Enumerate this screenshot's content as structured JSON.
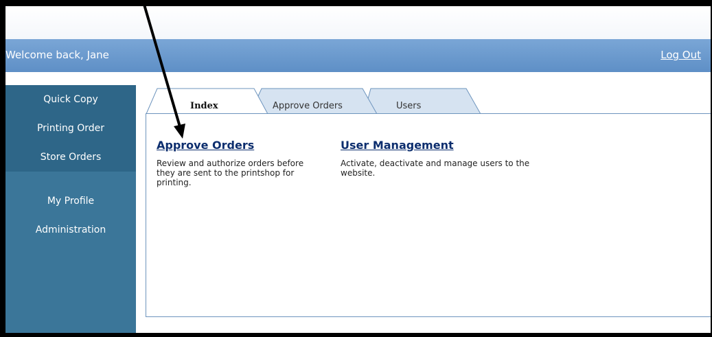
{
  "header": {
    "welcome_text": "Welcome back, Jane",
    "logout_label": "Log Out"
  },
  "sidebar": {
    "items": [
      {
        "label": "Quick Copy"
      },
      {
        "label": "Printing Order"
      },
      {
        "label": "Store Orders"
      },
      {
        "label": "My Profile"
      },
      {
        "label": "Administration"
      }
    ]
  },
  "tabs": [
    {
      "label": "Index",
      "active": true
    },
    {
      "label": "Approve Orders",
      "active": false
    },
    {
      "label": "Users",
      "active": false
    }
  ],
  "main": {
    "cards": [
      {
        "title": "Approve Orders",
        "description": "Review and authorize orders before they are sent to the printshop for printing."
      },
      {
        "title": "User Management",
        "description": "Activate, deactivate and manage users to the website."
      }
    ]
  },
  "colors": {
    "header": "#6b9ad0",
    "sidebar": "#3b7699",
    "link": "#0d2e6e",
    "tab_inactive": "#d6e3f1"
  }
}
